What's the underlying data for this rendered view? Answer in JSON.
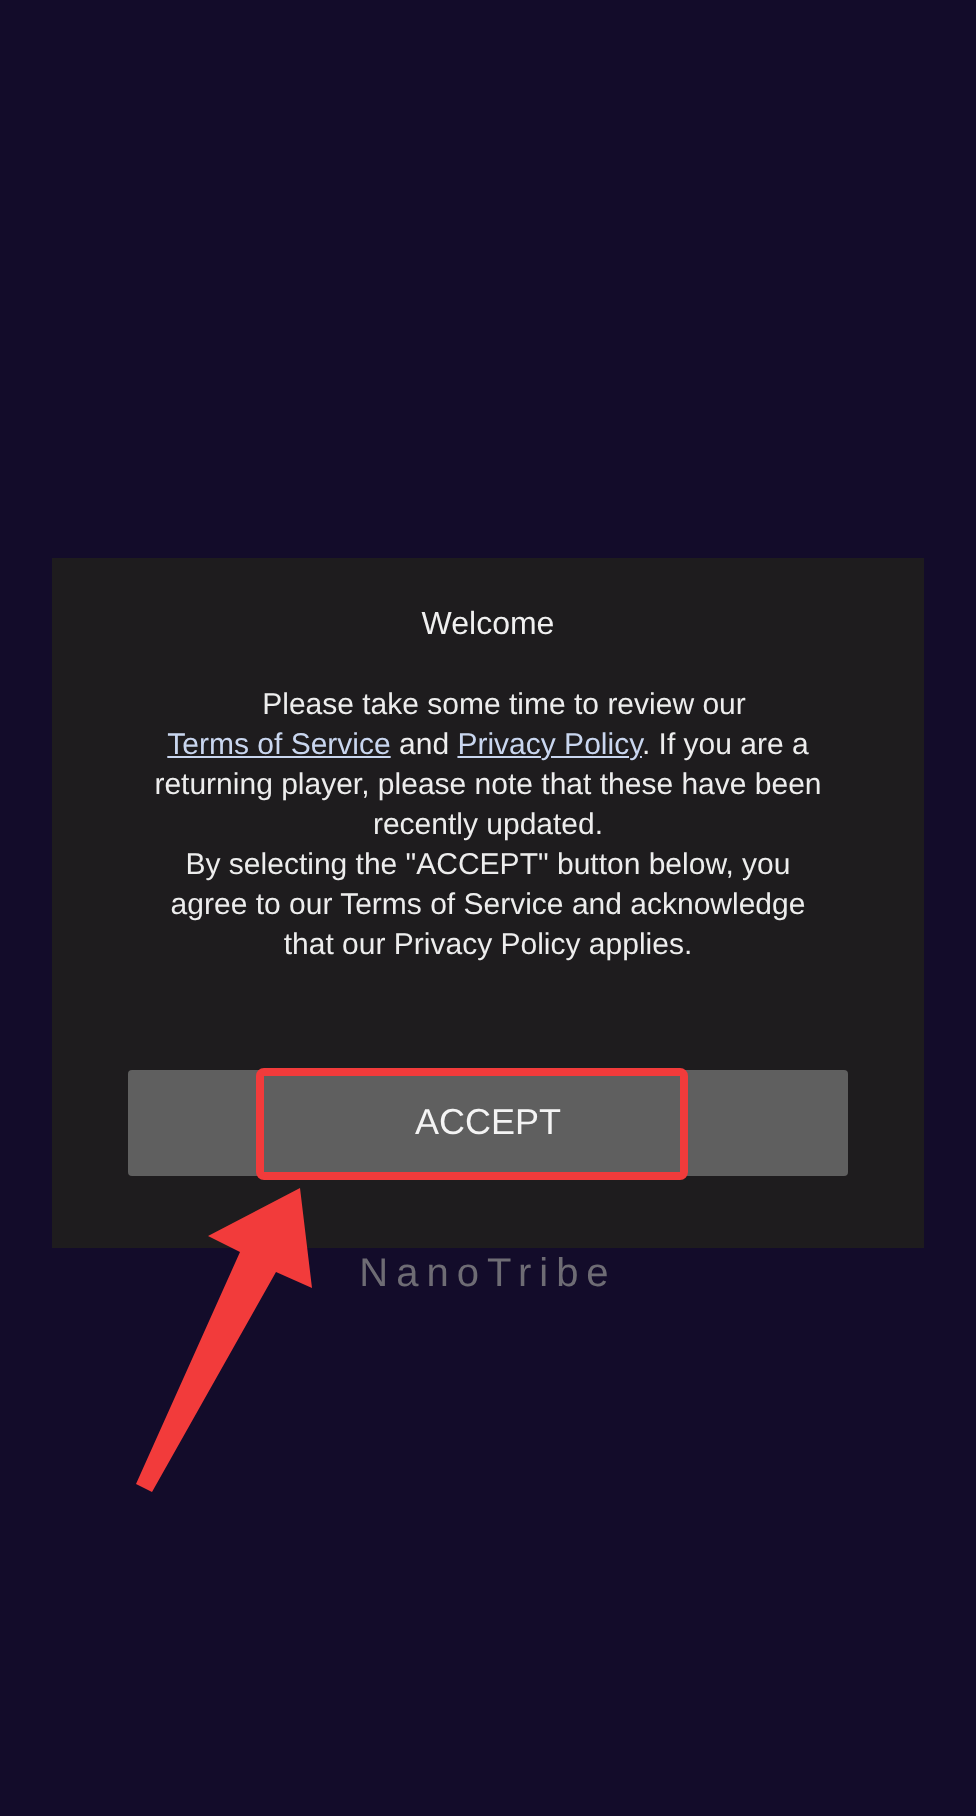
{
  "dialog": {
    "title": "Welcome",
    "paragraphs": [
      [
        {
          "kind": "text",
          "text": "Please take some time to review our "
        },
        {
          "kind": "link",
          "text": "Terms of Service"
        },
        {
          "kind": "text",
          "text": " and "
        },
        {
          "kind": "link",
          "text": "Privacy Policy"
        },
        {
          "kind": "text",
          "text": ". If you are a returning player, please note that these have been recently updated."
        }
      ],
      [
        {
          "kind": "text",
          "text": "By selecting the \"ACCEPT\" button below, you agree to our Terms of Service and acknowledge that our Privacy Policy applies."
        }
      ]
    ],
    "button": "ACCEPT"
  },
  "brand": "NanoTribe"
}
